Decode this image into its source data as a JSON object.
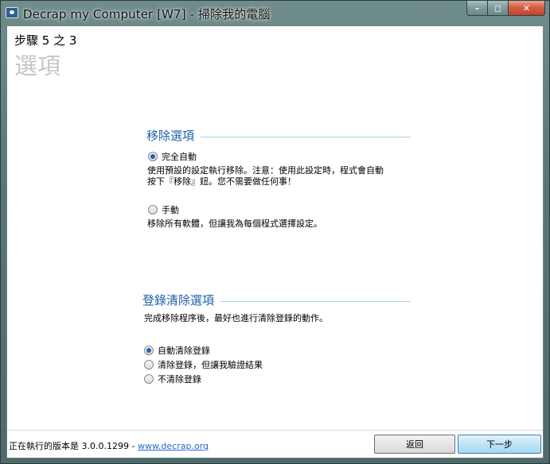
{
  "window": {
    "title": "Decrap my Computer [W7] - 掃除我的電腦",
    "min_glyph": "–",
    "max_glyph": "◻",
    "close_glyph": "✕"
  },
  "wizard": {
    "step": "步驟 5 之 3",
    "heading": "選項"
  },
  "removal": {
    "title": "移除選項",
    "options": [
      {
        "label": "完全自動",
        "checked": true,
        "desc": [
          "使用預設的設定執行移除。注意：使用此設定時，程式會自動",
          "按下『移除』鈕。您不需要做任何事！"
        ]
      },
      {
        "label": "手動",
        "checked": false,
        "desc": [
          "移除所有軟體，但讓我為每個程式選擇設定。"
        ]
      }
    ]
  },
  "registry": {
    "title": "登錄清除選項",
    "desc": "完成移除程序後，最好也進行清除登錄的動作。",
    "options": [
      {
        "label": "自動清除登錄",
        "checked": true
      },
      {
        "label": "清除登錄，但讓我驗證結果",
        "checked": false
      },
      {
        "label": "不清除登錄",
        "checked": false
      }
    ]
  },
  "footer": {
    "version_text": "正在執行的版本是 3.0.0.1299 - ",
    "link": "www.decrap.org",
    "back_label": "返回",
    "next_label": "下一步"
  },
  "colors": {
    "section_title": "#1f5fa8",
    "section_line": "#a8d0e3",
    "heading": "#c5c5c5",
    "link": "#2a67c7"
  }
}
